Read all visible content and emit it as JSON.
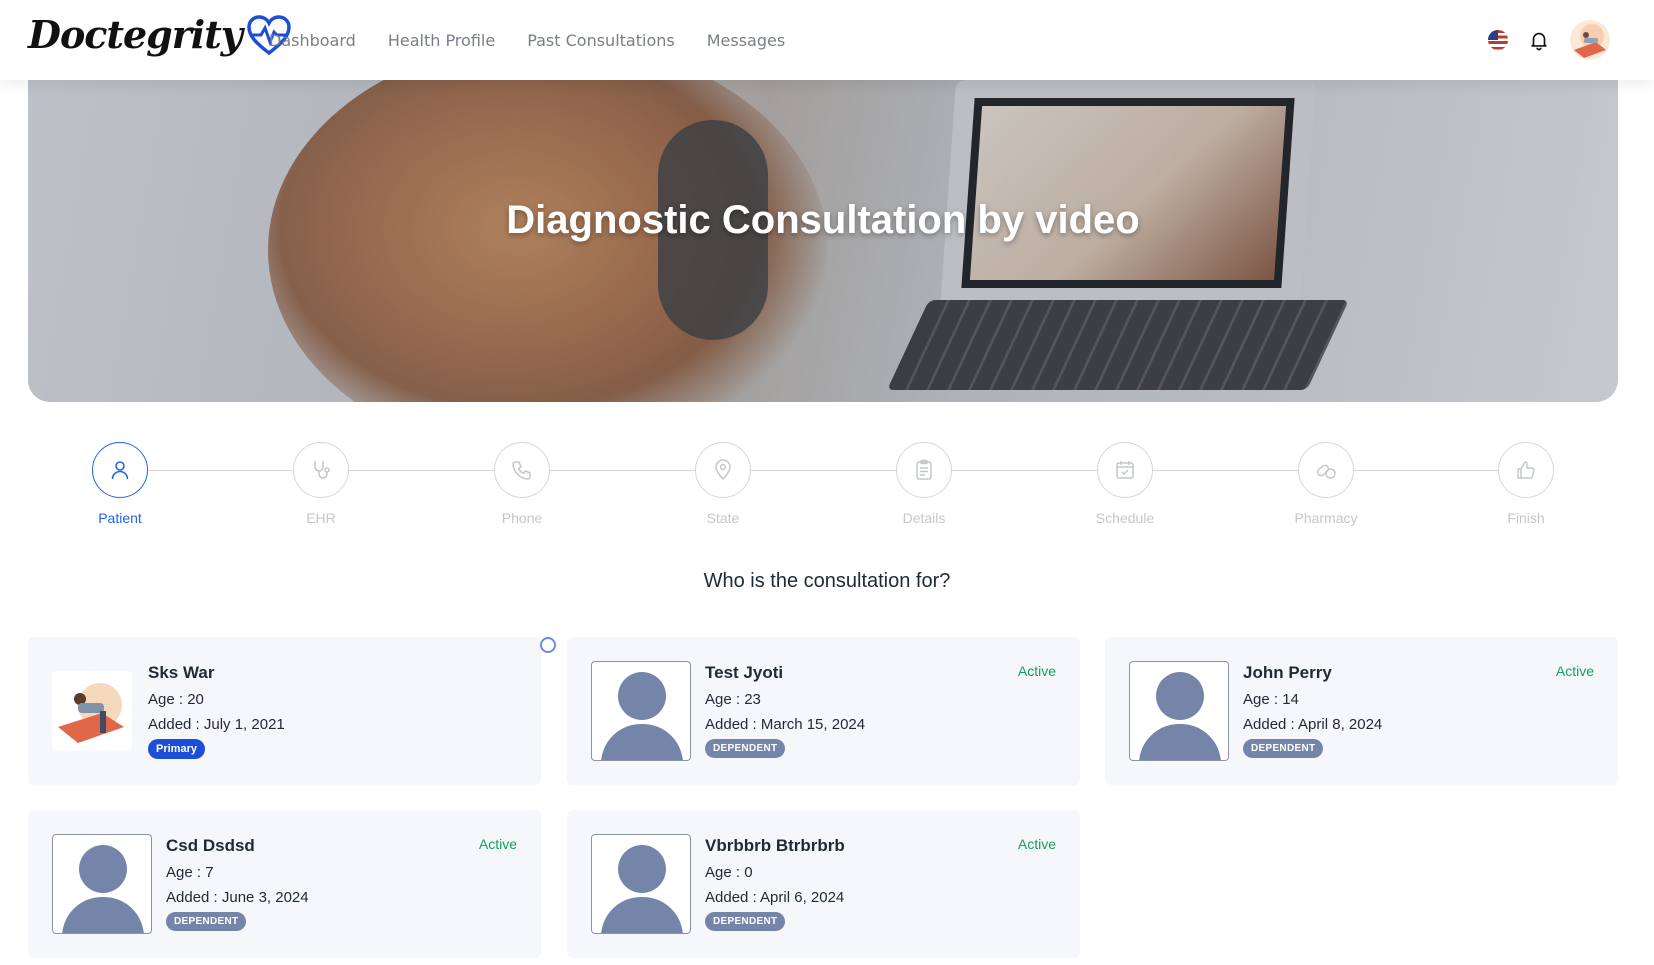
{
  "brand": {
    "name": "Doctegrity"
  },
  "nav": {
    "items": [
      "Dashboard",
      "Health Profile",
      "Past Consultations",
      "Messages"
    ]
  },
  "header_icons": [
    "us-flag-icon",
    "bell-icon",
    "user-avatar"
  ],
  "hero": {
    "title": "Diagnostic Consultation by video"
  },
  "stepper": {
    "steps": [
      {
        "label": "Patient",
        "icon": "user-icon",
        "state": "active"
      },
      {
        "label": "EHR",
        "icon": "stethoscope-icon",
        "state": "inactive"
      },
      {
        "label": "Phone",
        "icon": "phone-icon",
        "state": "inactive"
      },
      {
        "label": "State",
        "icon": "map-pin-icon",
        "state": "inactive"
      },
      {
        "label": "Details",
        "icon": "clipboard-icon",
        "state": "inactive"
      },
      {
        "label": "Schedule",
        "icon": "calendar-check-icon",
        "state": "inactive"
      },
      {
        "label": "Pharmacy",
        "icon": "pills-icon",
        "state": "inactive"
      },
      {
        "label": "Finish",
        "icon": "thumbs-up-icon",
        "state": "inactive"
      }
    ]
  },
  "question": "Who is the consultation for?",
  "patients": [
    {
      "name": "Sks War",
      "age": "Age : 20",
      "added": "Added : July 1, 2021",
      "badge": "Primary",
      "status": ""
    },
    {
      "name": "Test Jyoti",
      "age": "Age : 23",
      "added": "Added : March 15, 2024",
      "badge": "DEPENDENT",
      "status": "Active"
    },
    {
      "name": "John Perry",
      "age": "Age : 14",
      "added": "Added : April 8, 2024",
      "badge": "DEPENDENT",
      "status": "Active"
    },
    {
      "name": "Csd Dsdsd",
      "age": "Age : 7",
      "added": "Added : June 3, 2024",
      "badge": "DEPENDENT",
      "status": "Active"
    },
    {
      "name": "Vbrbbrb Btrbrbrb",
      "age": "Age : 0",
      "added": "Added : April 6, 2024",
      "badge": "DEPENDENT",
      "status": "Active"
    }
  ],
  "colors": {
    "accent": "#2563eb",
    "active_status": "#15a05a",
    "dependent_badge": "#7585a9",
    "primary_badge": "#1d4ed8",
    "card_bg": "#f6f7fb"
  }
}
